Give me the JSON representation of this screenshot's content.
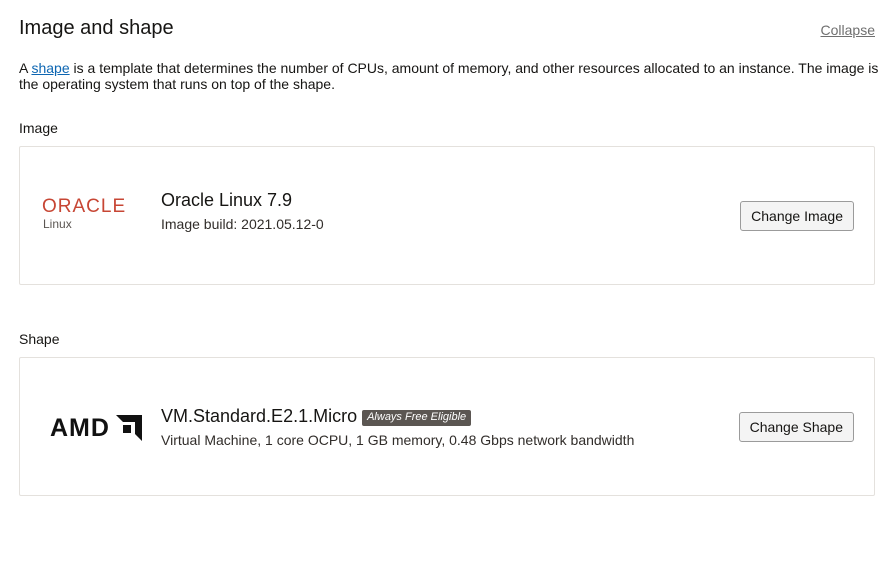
{
  "section": {
    "title": "Image and shape",
    "collapse_label": "Collapse",
    "description_prefix": "A ",
    "description_link": "shape",
    "description_suffix": " is a template that determines the number of CPUs, amount of memory, and other resources allocated to an instance. The image is the operating system that runs on top of the shape."
  },
  "image": {
    "label": "Image",
    "logo_brand": "ORACLE",
    "logo_sub": "Linux",
    "name": "Oracle Linux 7.9",
    "build": "Image build: 2021.05.12-0",
    "button": "Change Image",
    "logo_color": "#c74634"
  },
  "shape": {
    "label": "Shape",
    "logo_brand": "AMD",
    "name": "VM.Standard.E2.1.Micro",
    "badge": "Always Free Eligible",
    "details": "Virtual Machine, 1 core OCPU, 1 GB memory, 0.48 Gbps network bandwidth",
    "button": "Change Shape"
  },
  "colors": {
    "link": "#0d66b2",
    "badge_bg": "#5b5652",
    "border": "#e4e1dd"
  }
}
